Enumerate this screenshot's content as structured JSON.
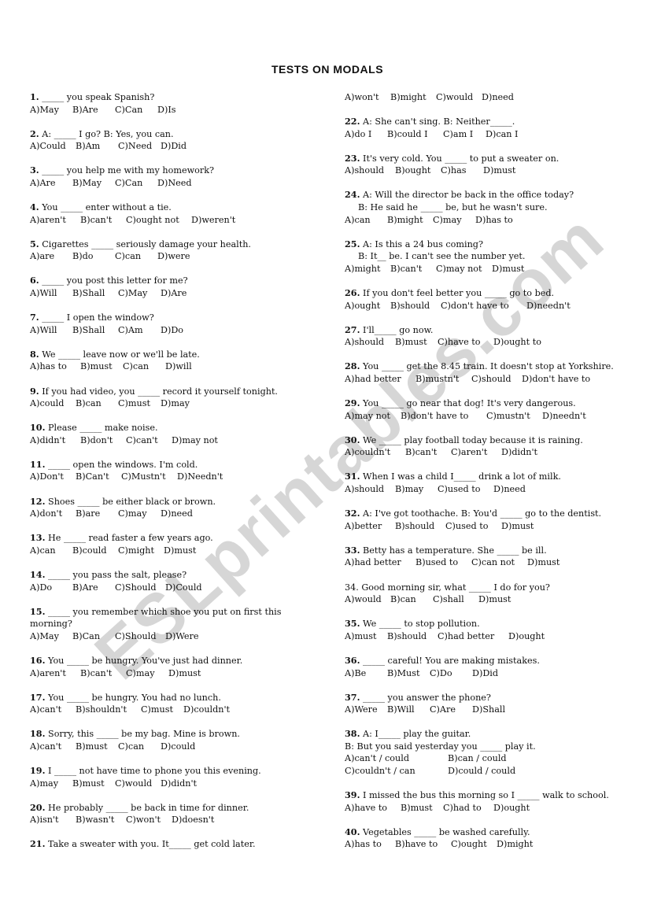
{
  "document": {
    "title": "TESTS ON MODALS",
    "watermark": "ESLprintables.com"
  },
  "left_column": [
    {
      "num": "1.",
      "lines": [
        "_____ you speak Spanish?"
      ],
      "options": [
        "A)May",
        "B)Are",
        "C)Can",
        "D)Is"
      ]
    },
    {
      "num": "2.",
      "lines": [
        "A: _____ I go? B: Yes, you can."
      ],
      "options": [
        "A)Could",
        "B)Am",
        "C)Need",
        "D)Did"
      ]
    },
    {
      "num": "3.",
      "lines": [
        "_____ you help me with my homework?"
      ],
      "options": [
        "A)Are",
        "B)May",
        "C)Can",
        "D)Need"
      ]
    },
    {
      "num": "4.",
      "lines": [
        "You _____ enter without a tie."
      ],
      "options": [
        "A)aren't",
        "B)can't",
        "C)ought not",
        "D)weren't"
      ]
    },
    {
      "num": "5.",
      "lines": [
        "Cigarettes _____ seriously damage your health."
      ],
      "options": [
        "A)are",
        "B)do",
        "C)can",
        "D)were"
      ]
    },
    {
      "num": "6.",
      "lines": [
        "_____ you post this letter for me?"
      ],
      "options": [
        "A)Will",
        "B)Shall",
        "C)May",
        "D)Are"
      ]
    },
    {
      "num": "7.",
      "lines": [
        "_____ I open the window?"
      ],
      "options": [
        "A)Will",
        "B)Shall",
        "C)Am",
        "D)Do"
      ]
    },
    {
      "num": "8.",
      "lines": [
        "We _____ leave now or we'll be late."
      ],
      "options": [
        "A)has to",
        "B)must",
        "C)can",
        "D)will"
      ]
    },
    {
      "num": "9.",
      "lines": [
        "If you had video, you _____ record it yourself tonight."
      ],
      "options": [
        "A)could",
        "B)can",
        "C)must",
        "D)may"
      ]
    },
    {
      "num": "10.",
      "lines": [
        "Please _____ make noise."
      ],
      "options": [
        "A)didn't",
        "B)don't",
        "C)can't",
        "D)may not"
      ]
    },
    {
      "num": "11.",
      "lines": [
        "_____ open the windows. I'm cold."
      ],
      "options": [
        "A)Don't",
        "B)Can't",
        "C)Mustn't",
        "D)Needn't"
      ]
    },
    {
      "num": "12.",
      "lines": [
        "Shoes _____ be either black or brown."
      ],
      "options": [
        "A)don't",
        "B)are",
        "C)may",
        "D)need"
      ]
    },
    {
      "num": "13.",
      "lines": [
        "He _____ read faster a few years ago."
      ],
      "options": [
        "A)can",
        "B)could",
        "C)might",
        "D)must"
      ]
    },
    {
      "num": "14.",
      "lines": [
        "_____ you pass the salt, please?"
      ],
      "options": [
        "A)Do",
        "B)Are",
        "C)Should",
        "D)Could"
      ]
    },
    {
      "num": "15.",
      "lines": [
        "_____ you remember which shoe you put on first this",
        "morning?"
      ],
      "options": [
        "A)May",
        "B)Can",
        "C)Should",
        "D)Were"
      ]
    },
    {
      "num": "16.",
      "lines": [
        "You _____ be hungry. You've just had dinner."
      ],
      "options": [
        "A)aren't",
        "B)can't",
        "C)may",
        "D)must"
      ]
    },
    {
      "num": "17.",
      "lines": [
        "You _____ be hungry. You had no lunch."
      ],
      "options": [
        "A)can't",
        "B)shouldn't",
        "C)must",
        "D)couldn't"
      ]
    },
    {
      "num": "18.",
      "lines": [
        "Sorry, this _____ be my bag. Mine is brown."
      ],
      "options": [
        "A)can't",
        "B)must",
        "C)can",
        "D)could"
      ]
    },
    {
      "num": "19.",
      "lines": [
        "I _____ not have time to phone you this evening."
      ],
      "options": [
        "A)may",
        "B)must",
        "C)would",
        "D)didn't"
      ]
    },
    {
      "num": "20.",
      "lines": [
        "He probably _____ be back in time for dinner."
      ],
      "options": [
        "A)isn't",
        "B)wasn't",
        "C)won't",
        "D)doesn't"
      ]
    },
    {
      "num": "21.",
      "lines": [
        "Take a sweater with you. It_____ get cold later."
      ],
      "options": []
    }
  ],
  "right_column_continuation": {
    "options": [
      "A)won't",
      "B)might",
      "C)would",
      "D)need"
    ]
  },
  "right_column": [
    {
      "num": "22.",
      "lines": [
        "A: She can't sing.   B: Neither_____."
      ],
      "options": [
        "A)do I",
        "B)could I",
        "C)am I",
        "D)can I"
      ]
    },
    {
      "num": "23.",
      "lines": [
        "It's very cold. You _____ to put a sweater on."
      ],
      "options": [
        "A)should",
        "B)ought",
        "C)has",
        "D)must"
      ]
    },
    {
      "num": "24.",
      "lines": [
        "A: Will the director be back in the office today?",
        "B: He said he _____ be, but he wasn't sure."
      ],
      "options": [
        "A)can",
        "B)might",
        "C)may",
        "D)has to"
      ]
    },
    {
      "num": "25.",
      "lines": [
        "A: Is this a 24 bus coming?",
        "B: It__ be. I can't see the number yet."
      ],
      "options": [
        "A)might",
        "B)can't",
        "C)may not",
        "D)must"
      ]
    },
    {
      "num": "26.",
      "lines": [
        "If you don't feel better you _____ go to bed."
      ],
      "options": [
        "A)ought",
        "B)should",
        "C)don't have to",
        "D)needn't"
      ]
    },
    {
      "num": "27.",
      "lines": [
        "I'll_____ go now."
      ],
      "options": [
        "A)should",
        "B)must",
        "C)have to",
        "D)ought to"
      ]
    },
    {
      "num": "28.",
      "lines": [
        "You _____ get the 8.45 train. It doesn't stop at Yorkshire."
      ],
      "options": [
        "A)had better",
        "B)mustn't",
        "C)should",
        "D)don't have to"
      ]
    },
    {
      "num": "29.",
      "lines": [
        "You _____ go near that dog! It's very dangerous."
      ],
      "options": [
        "A)may not",
        "B)don't have to",
        "C)mustn't",
        "D)needn't"
      ]
    },
    {
      "num": "30.",
      "lines": [
        "We _____ play football today because it is raining."
      ],
      "options": [
        "A)couldn't",
        "B)can't",
        "C)aren't",
        "D)didn't"
      ]
    },
    {
      "num": "31.",
      "lines": [
        "When I was a child I_____ drink a lot of milk."
      ],
      "options": [
        "A)should",
        "B)may",
        "C)used to",
        "D)need"
      ]
    },
    {
      "num": "32.",
      "lines": [
        "A: I've got toothache. B: You'd _____ go to the dentist."
      ],
      "options": [
        "A)better",
        "B)should",
        "C)used to",
        "D)must"
      ]
    },
    {
      "num": "33.",
      "lines": [
        "Betty has a temperature. She _____ be ill."
      ],
      "options": [
        "A)had better",
        "B)used to",
        "C)can not",
        "D)must"
      ]
    },
    {
      "num": "34.",
      "lines": [
        "Good morning sir, what _____ I do for you?"
      ],
      "options": [
        "A)would",
        "B)can",
        "C)shall",
        "D)must"
      ],
      "num_bold": false
    },
    {
      "num": "35.",
      "lines": [
        "We _____ to stop pollution."
      ],
      "options": [
        "A)must",
        "B)should",
        "C)had better",
        "D)ought"
      ]
    },
    {
      "num": "36.",
      "lines": [
        "_____ careful! You are making mistakes."
      ],
      "options": [
        "A)Be",
        "B)Must",
        "C)Do",
        "D)Did"
      ]
    },
    {
      "num": "37.",
      "lines": [
        "_____ you answer the phone?"
      ],
      "options": [
        "A)Were",
        "B)Will",
        "C)Are",
        "D)Shall"
      ]
    },
    {
      "num": "38.",
      "lines": [
        "A: I_____ play the guitar.",
        "B: But you said yesterday you _____ play it."
      ],
      "options": [
        "A)can't / could",
        "B)can / could",
        "C)couldn't / can",
        "D)could / could"
      ],
      "grid": true
    },
    {
      "num": "39.",
      "lines": [
        "I missed the bus this morning so I _____ walk to school."
      ],
      "options": [
        "A)have to",
        "B)must",
        "C)had to",
        "D)ought"
      ]
    },
    {
      "num": "40.",
      "lines": [
        "Vegetables _____ be washed carefully."
      ],
      "options": [
        "A)has to",
        "B)have to",
        "C)ought",
        "D)might"
      ]
    }
  ]
}
